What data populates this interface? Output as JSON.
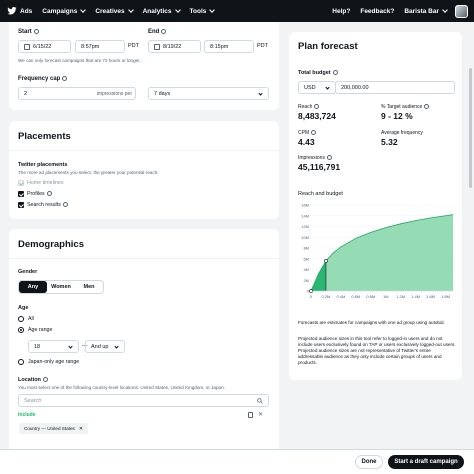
{
  "nav": {
    "brand": "Ads",
    "menu": [
      {
        "label": "Campaigns"
      },
      {
        "label": "Creatives"
      },
      {
        "label": "Analytics"
      },
      {
        "label": "Tools"
      }
    ],
    "help": "Help?",
    "feedback": "Feedback?",
    "account": "Barista Bar"
  },
  "schedule": {
    "start_label": "Start",
    "start_date": "6/15/22",
    "start_time": "8:57pm",
    "start_tz": "PDT",
    "end_label": "End",
    "end_date": "8/19/22",
    "end_time": "8:15pm",
    "end_tz": "PDT",
    "note": "We can only forecast campaigns that are 72 hours or longer."
  },
  "frequency": {
    "label": "Frequency cap",
    "value": "2",
    "unit": "impressions per",
    "period": "7 days"
  },
  "placements": {
    "title": "Placements",
    "subtitle": "Twitter placements",
    "description": "The more ad placements you select, the greater your potential reach.",
    "options": [
      {
        "label": "Home timelines",
        "checked": true,
        "disabled": true
      },
      {
        "label": "Profiles",
        "checked": true,
        "disabled": false
      },
      {
        "label": "Search results",
        "checked": true,
        "disabled": false
      }
    ]
  },
  "demographics": {
    "title": "Demographics",
    "gender_label": "Gender",
    "gender_options": [
      "Any",
      "Women",
      "Men"
    ],
    "gender_selected": "Any",
    "age_label": "Age",
    "age_all": "All",
    "age_range": "Age range",
    "age_min": "18",
    "age_sep": "—",
    "age_max": "And up",
    "japan_only": "Japan-only age range",
    "location_label": "Location",
    "location_note": "You must select one of the following country-level locations: United States, United Kingdom, or Japan.",
    "search_placeholder": "Search",
    "include_label": "Include",
    "include_tag": "Country — United States"
  },
  "forecast": {
    "title": "Plan forecast",
    "budget_label": "Total budget",
    "currency": "USD",
    "budget_value": "200,000.00",
    "reach_label": "Reach",
    "reach_value": "8,483,724",
    "target_label": "% Target audience",
    "target_value": "9 - 12 %",
    "cpm_label": "CPM",
    "cpm_value": "4.43",
    "avg_freq_label": "Average frequency",
    "avg_freq_value": "5.32",
    "impressions_label": "Impressions",
    "impressions_value": "45,116,791",
    "chart_label": "Reach and budget",
    "disclaimer1": "Forecasts are estimates for campaigns with one ad group using autobid.",
    "disclaimer2": "Projected audience sizes in this tool refer to logged-in users and do not include users exclusively found on TAP or users exclusively logged-out users. Projected audience sizes are not representative of Twitter's entire addressable audience as they only include certain groups of users and products."
  },
  "chart_data": {
    "type": "area",
    "title": "Reach and budget",
    "x": [
      "0",
      "0.2M",
      "0.4M",
      "0.6M",
      "0.8M",
      "1M",
      "1.2M",
      "1.4M",
      "1.6M",
      "1.8M"
    ],
    "y_ticks": [
      "0",
      "2M",
      "4M",
      "6M",
      "8M",
      "10M",
      "12M",
      "14M",
      "16M"
    ],
    "ylim": [
      0,
      16000000
    ],
    "xlim": [
      0,
      1900000
    ],
    "series": [
      {
        "x": [
          0,
          50000,
          100000,
          200000,
          300000,
          400000,
          600000,
          800000,
          1000000,
          1200000,
          1400000,
          1600000,
          1800000,
          1900000
        ],
        "y": [
          0,
          1600000,
          3200000,
          5600000,
          7100000,
          8200000,
          9800000,
          10900000,
          11800000,
          12500000,
          13100000,
          13600000,
          14000000,
          14200000
        ]
      }
    ],
    "markers": [
      {
        "x": 200000,
        "y": 8483724
      },
      {
        "x": 0,
        "y": 0
      }
    ],
    "highlight_until": 200000,
    "colors": {
      "area": "#7ad3a2",
      "area_highlight": "#2bb673",
      "line": "#1fa463"
    }
  },
  "actions": {
    "done": "Done",
    "start_draft": "Start a draft campaign"
  }
}
